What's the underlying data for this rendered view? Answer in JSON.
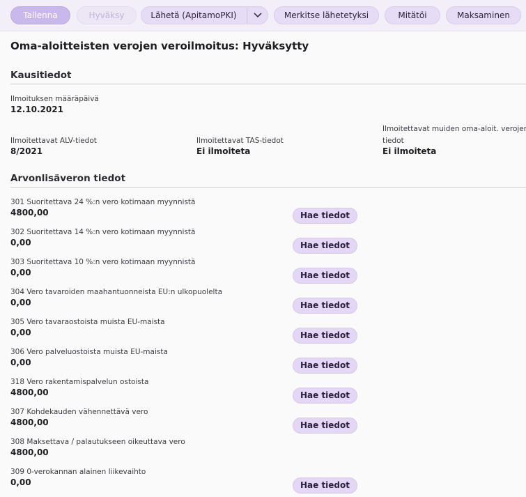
{
  "toolbar": {
    "save": "Tallenna",
    "approve": "Hyväksy",
    "send": "Lähetä (ApitamoPKI)",
    "mark_sent": "Merkitse lähetetyksi",
    "cancel": "Mitätöi",
    "payment": "Maksaminen",
    "dropdown_icon": "chevron-down-icon"
  },
  "page": {
    "title": "Oma-aloitteisten verojen veroilmoitus: Hyväksytty"
  },
  "period": {
    "heading": "Kausitiedot",
    "due_label": "Ilmoituksen määräpäivä",
    "due_value": "12.10.2021",
    "vat_label": "Ilmoitettavat ALV-tiedot",
    "vat_value": "8/2021",
    "tas_label": "Ilmoitettavat TAS-tiedot",
    "tas_value": "Ei ilmoiteta",
    "other_label": "Ilmoitettavat muiden oma-aloit. verojen tiedot",
    "other_value": "Ei ilmoiteta"
  },
  "vat": {
    "heading": "Arvonlisäveron tiedot",
    "fetch_label": "Hae tiedot",
    "rows": [
      {
        "label": "301 Suoritettava 24 %:n vero kotimaan myynnistä",
        "value": "4800,00"
      },
      {
        "label": "302 Suoritettava 14 %:n vero kotimaan myynnistä",
        "value": "0,00"
      },
      {
        "label": "303 Suoritettava 10 %:n vero kotimaan myynnistä",
        "value": "0,00"
      },
      {
        "label": "304 Vero tavaroiden maahantuonneista EU:n ulkopuolelta",
        "value": "0,00"
      },
      {
        "label": "305 Vero tavaraostoista muista EU-maista",
        "value": "0,00"
      },
      {
        "label": "306 Vero palveluostoista muista EU-maista",
        "value": "0,00"
      },
      {
        "label": "318 Vero rakentamispalvelun ostoista",
        "value": "4800,00"
      },
      {
        "label": "307 Kohdekauden vähennettävä vero",
        "value": "4800,00"
      },
      {
        "label": "308 Maksettava / palautukseen oikeuttava vero",
        "value": "4800,00"
      },
      {
        "label": "309 0-verokannan alainen liikevaihto",
        "value": "0,00"
      }
    ]
  }
}
